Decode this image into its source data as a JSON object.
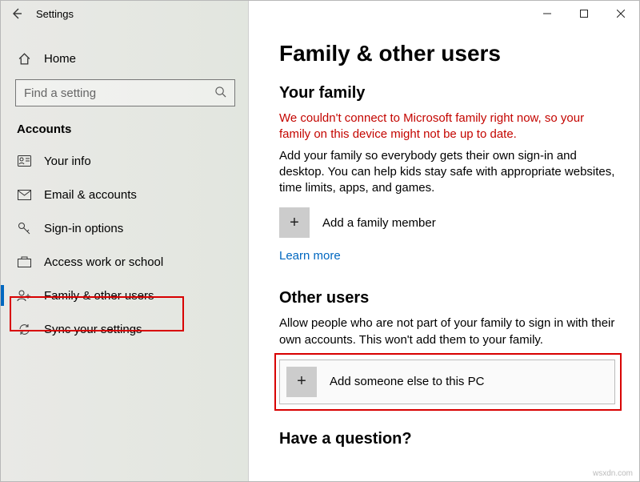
{
  "titlebar": {
    "title": "Settings"
  },
  "sidebar": {
    "home": "Home",
    "search_placeholder": "Find a setting",
    "section": "Accounts",
    "items": [
      {
        "label": "Your info"
      },
      {
        "label": "Email & accounts"
      },
      {
        "label": "Sign-in options"
      },
      {
        "label": "Access work or school"
      },
      {
        "label": "Family & other users"
      },
      {
        "label": "Sync your settings"
      }
    ]
  },
  "main": {
    "title": "Family & other users",
    "family": {
      "heading": "Your family",
      "error": "We couldn't connect to Microsoft family right now, so your family on this device might not be up to date.",
      "desc": "Add your family so everybody gets their own sign-in and desktop. You can help kids stay safe with appropriate websites, time limits, apps, and games.",
      "add_label": "Add a family member",
      "learn_more": "Learn more"
    },
    "other": {
      "heading": "Other users",
      "desc": "Allow people who are not part of your family to sign in with their own accounts. This won't add them to your family.",
      "add_label": "Add someone else to this PC"
    },
    "question": "Have a question?"
  },
  "watermark": "wsxdn.com"
}
